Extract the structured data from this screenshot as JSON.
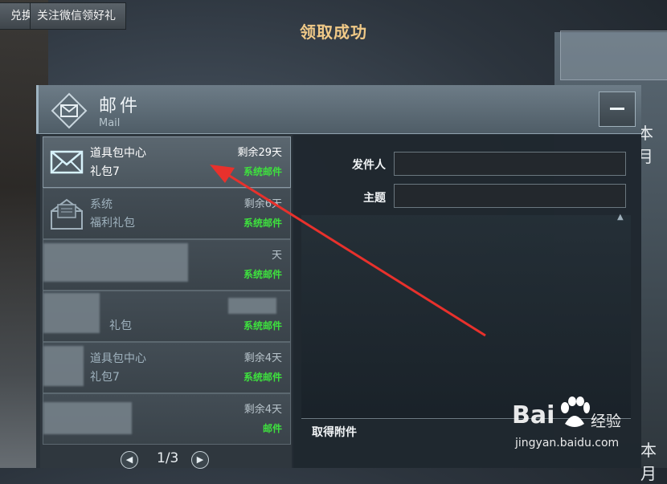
{
  "top_buttons": {
    "exchange_label": "兑换",
    "wechat_label": "关注微信领好礼"
  },
  "toast": {
    "title": "领取成功"
  },
  "side_texts": {
    "upper": "本月",
    "lower": "本月"
  },
  "mail": {
    "title": "邮件",
    "subtitle": "Mail",
    "items": [
      {
        "sender": "道具包中心",
        "subject": "礼包7",
        "remaining": "剩余29天",
        "type": "系统邮件",
        "state": "selected"
      },
      {
        "sender": "系统",
        "subject": "福利礼包",
        "remaining": "剩余6天",
        "type": "系统邮件",
        "state": "read"
      },
      {
        "sender": "",
        "subject": "",
        "remaining": "天",
        "type": "系统邮件",
        "state": "obscured"
      },
      {
        "sender": "",
        "subject": "礼包",
        "remaining": "",
        "type": "系统邮件",
        "state": "obscured"
      },
      {
        "sender": "道具包中心",
        "subject": "礼包7",
        "remaining": "剩余4天",
        "type": "系统邮件",
        "state": "obscured"
      },
      {
        "sender": "",
        "subject": "",
        "remaining": "剩余4天",
        "type": "邮件",
        "state": "obscured"
      }
    ],
    "pagination": {
      "current": "1/3",
      "prev_icon": "chevron-left-icon",
      "next_icon": "chevron-right-icon"
    },
    "detail": {
      "sender_label": "发件人",
      "sender_value": "",
      "subject_label": "主题",
      "subject_value": "",
      "attachment_label": "取得附件"
    }
  },
  "watermark": {
    "brand": "Bai",
    "brand_cn": "经验",
    "url": "jingyan.baidu.com"
  },
  "colors": {
    "system_mail_green": "#3ee03e",
    "toast_gold": "#f0c987",
    "annotation_red": "#e8312c"
  }
}
